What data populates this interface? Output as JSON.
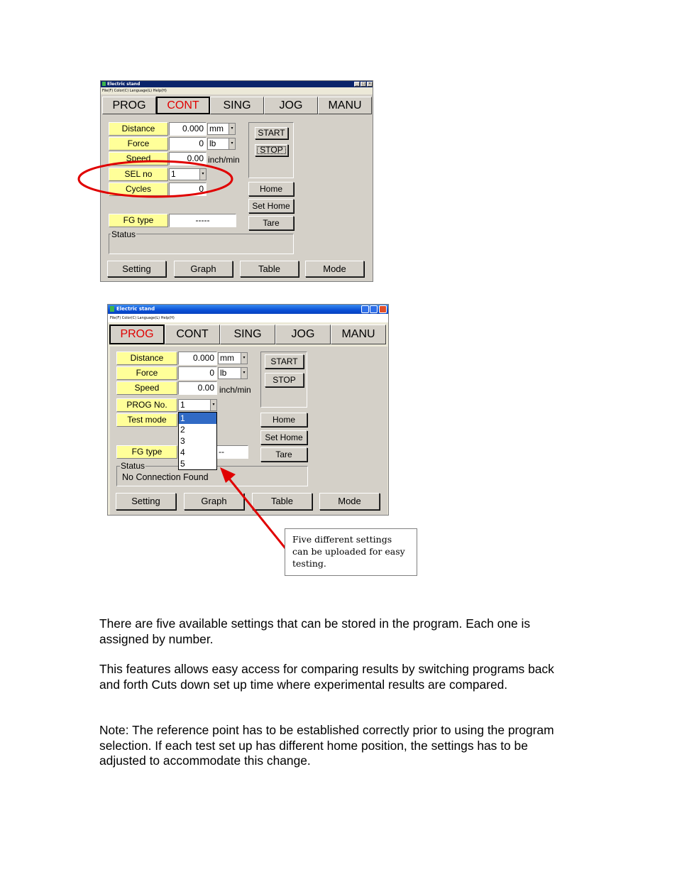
{
  "screen1": {
    "title": "Electric stand",
    "menu": "File(F)   Color(C)   Language(L)   Help(H)",
    "tabs": [
      "PROG",
      "CONT",
      "SING",
      "JOG",
      "MANU"
    ],
    "labels": {
      "distance": "Distance",
      "force": "Force",
      "speed": "Speed",
      "sel_no": "SEL  no",
      "cycles": "Cycles",
      "fg_type": "FG type",
      "status": "Status"
    },
    "values": {
      "distance": "0.000",
      "force": "0",
      "speed": "0.00",
      "sel_no": "1",
      "cycles": "0",
      "fg_type": "-----"
    },
    "units": {
      "distance": "mm",
      "force": "lb",
      "speed": "inch/min"
    },
    "buttons": {
      "start": "START",
      "stop": "STOP",
      "home": "Home",
      "set_home": "Set Home",
      "tare": "Tare",
      "setting": "Setting",
      "graph": "Graph",
      "table": "Table",
      "mode": "Mode"
    }
  },
  "screen2": {
    "title": "Electric stand",
    "menu": "File(F)   Color(C)   Language(L)   Help(H)",
    "tabs": [
      "PROG",
      "CONT",
      "SING",
      "JOG",
      "MANU"
    ],
    "labels": {
      "distance": "Distance",
      "force": "Force",
      "speed": "Speed",
      "prog_no": "PROG No.",
      "test_mode": "Test mode",
      "fg_type": "FG type",
      "status": "Status"
    },
    "values": {
      "distance": "0.000",
      "force": "0",
      "speed": "0.00",
      "prog_no": "1",
      "fg_type": "--"
    },
    "units": {
      "distance": "mm",
      "force": "lb",
      "speed": "inch/min"
    },
    "dropdown_options": [
      "1",
      "2",
      "3",
      "4",
      "5"
    ],
    "status_text": "No Connection Found",
    "buttons": {
      "start": "START",
      "stop": "STOP",
      "home": "Home",
      "set_home": "Set Home",
      "tare": "Tare",
      "setting": "Setting",
      "graph": "Graph",
      "table": "Table",
      "mode": "Mode"
    }
  },
  "callout": "Five different settings can be uploaded for easy testing.",
  "colors": {
    "highlight_circle": "#e00000",
    "arrow": "#e00000",
    "label_bg": "#ffff99",
    "active_tab": "#e00000"
  },
  "paragraphs": [
    "There are five available settings that can be stored in the program.  Each one is assigned by number.",
    "This features allows easy access for comparing results by switching programs back and forth   Cuts down set up time where experimental results are compared.",
    "Note:  The reference point has to be established correctly prior to using the program selection.  If each test set up has different home position, the settings has to be adjusted to accommodate this change."
  ]
}
